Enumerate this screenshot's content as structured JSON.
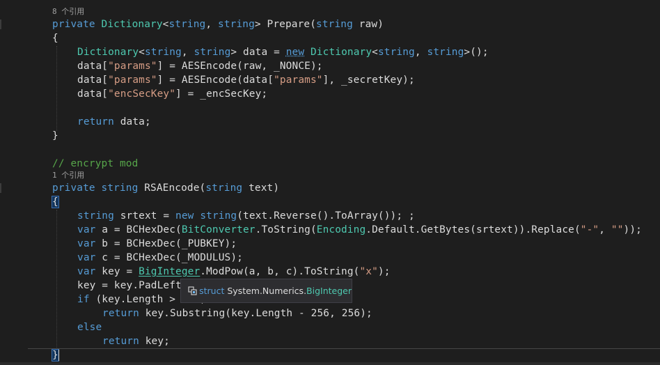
{
  "colors": {
    "background": "#1e1e1e",
    "keyword": "#569cd6",
    "type": "#4ec9b0",
    "string": "#d69d85",
    "comment": "#57a64a",
    "text": "#dcdcdc"
  },
  "code": {
    "refs_prepare": "8 个引用",
    "l1": {
      "a": "private ",
      "b": "Dictionary",
      "c": "<",
      "d": "string",
      "e": ", ",
      "f": "string",
      "g": "> Prepare(",
      "h": "string",
      "i": " raw)"
    },
    "l2": {
      "a": "{"
    },
    "l3": {
      "a": "Dictionary",
      "b": "<",
      "c": "string",
      "d": ", ",
      "e": "string",
      "f": "> data = ",
      "g": "new",
      "h": " ",
      "i": "Dictionary",
      "j": "<",
      "k": "string",
      "l": ", ",
      "m": "string",
      "n": ">();"
    },
    "l4": {
      "a": "data[",
      "b": "\"params\"",
      "c": "] = AESEncode(raw, _NONCE);"
    },
    "l5": {
      "a": "data[",
      "b": "\"params\"",
      "c": "] = AESEncode(data[",
      "d": "\"params\"",
      "e": "], _secretKey);"
    },
    "l6": {
      "a": "data[",
      "b": "\"encSecKey\"",
      "c": "] = _encSecKey;"
    },
    "l7": {
      "a": "return",
      "b": " data;"
    },
    "l8": {
      "a": "}"
    },
    "l9": {
      "a": "// encrypt mod"
    },
    "refs_rsa": "1 个引用",
    "l10": {
      "a": "private ",
      "b": "string",
      "c": " RSAEncode(",
      "d": "string",
      "e": " text)"
    },
    "l11": {
      "a": "{"
    },
    "l12": {
      "a": "string",
      "b": " srtext = ",
      "c": "new",
      "d": " ",
      "e": "string",
      "f": "(text.Reverse().ToArray()); ;"
    },
    "l13": {
      "a": "var",
      "b": " a = BCHexDec(",
      "c": "BitConverter",
      "d": ".ToString(",
      "e": "Encoding",
      "f": ".Default.GetBytes(srtext)).Replace(",
      "g": "\"-\"",
      "h": ", ",
      "i": "\"\"",
      "j": "));"
    },
    "l14": {
      "a": "var",
      "b": " b = BCHexDec(_PUBKEY);"
    },
    "l15": {
      "a": "var",
      "b": " c = BCHexDec(_MODULUS);"
    },
    "l16": {
      "a": "var",
      "b": " key = ",
      "c": "BigInteger",
      "d": ".ModPow(a, b, c).ToString(",
      "e": "\"x\"",
      "f": ");"
    },
    "l17": {
      "a": "key = key.PadLeft"
    },
    "l18": {
      "a": "if",
      "b": " (key.Length > 256)"
    },
    "l19": {
      "a": "return",
      "b": " key.Substring(key.Length - 256, 256);"
    },
    "l20": {
      "a": "else"
    },
    "l21": {
      "a": "return",
      "b": " key;"
    },
    "l22": {
      "a": "}"
    }
  },
  "tooltip": {
    "icon": "struct-icon",
    "kind": "struct",
    "namespace": "System.Numerics.",
    "type": "BigInteger"
  }
}
